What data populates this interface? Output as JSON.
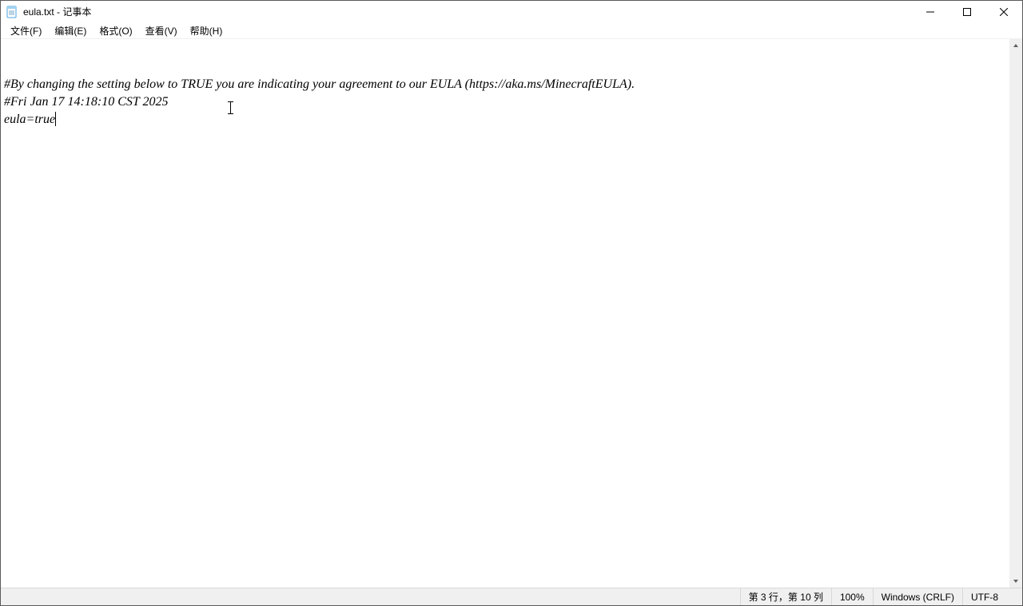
{
  "window": {
    "title": "eula.txt - 记事本"
  },
  "menu": {
    "file": "文件(F)",
    "edit": "编辑(E)",
    "format": "格式(O)",
    "view": "查看(V)",
    "help": "帮助(H)"
  },
  "content": {
    "line1": "#By changing the setting below to TRUE you are indicating your agreement to our EULA (https://aka.ms/MinecraftEULA).",
    "line2": "#Fri Jan 17 14:18:10 CST 2025",
    "line3": "eula=true"
  },
  "status": {
    "position": "第 3 行，第 10 列",
    "zoom": "100%",
    "eol": "Windows (CRLF)",
    "encoding": "UTF-8"
  }
}
